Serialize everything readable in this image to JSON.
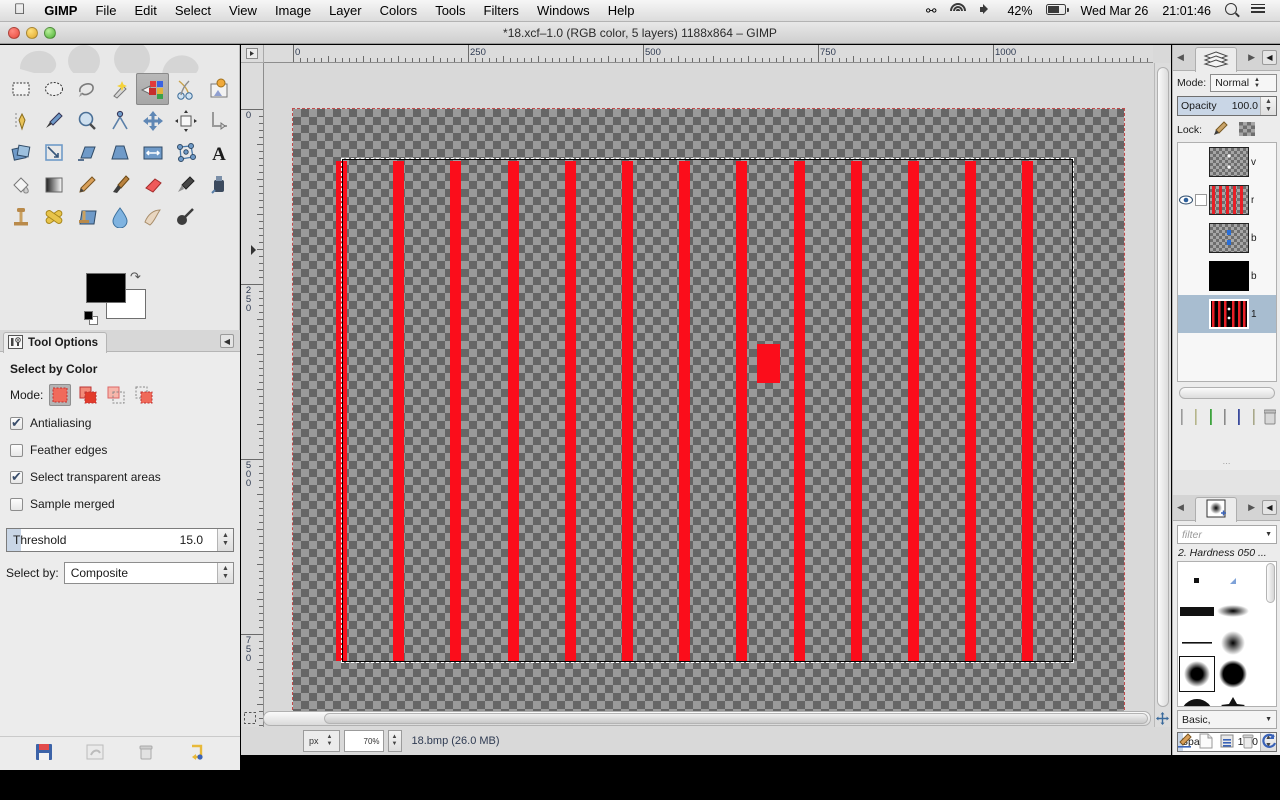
{
  "menubar": {
    "apple_icon": "apple-icon",
    "app_name": "GIMP",
    "items": [
      "File",
      "Edit",
      "Select",
      "View",
      "Image",
      "Layer",
      "Colors",
      "Tools",
      "Filters",
      "Windows",
      "Help"
    ],
    "status": {
      "bluetooth_icon": "bluetooth-icon",
      "wifi_icon": "wifi-icon",
      "volume_icon": "volume-icon",
      "battery_percent": "42%",
      "battery_icon": "battery-icon",
      "date": "Wed Mar 26",
      "time": "21:01:46",
      "search_icon": "search-icon",
      "menu_icon": "list-menu-icon"
    }
  },
  "window": {
    "title": "*18.xcf–1.0 (RGB color, 5 layers) 1188x864 – GIMP",
    "close_label": "close-button",
    "minimize_label": "minimize-button",
    "zoom_label": "zoom-button"
  },
  "toolbox": {
    "tools": [
      {
        "id": "rect-select-tool",
        "selected": false
      },
      {
        "id": "ellipse-select-tool",
        "selected": false
      },
      {
        "id": "free-select-tool",
        "selected": false
      },
      {
        "id": "fuzzy-select-tool",
        "selected": false
      },
      {
        "id": "select-by-color-tool",
        "selected": true
      },
      {
        "id": "scissors-select-tool",
        "selected": false
      },
      {
        "id": "foreground-select-tool",
        "selected": false
      },
      {
        "id": "paths-tool",
        "selected": false
      },
      {
        "id": "color-picker-tool",
        "selected": false
      },
      {
        "id": "zoom-tool",
        "selected": false
      },
      {
        "id": "measure-tool",
        "selected": false
      },
      {
        "id": "move-tool",
        "selected": false
      },
      {
        "id": "alignment-tool",
        "selected": false
      },
      {
        "id": "crop-tool",
        "selected": false
      },
      {
        "id": "rotate-tool",
        "selected": false
      },
      {
        "id": "scale-tool",
        "selected": false
      },
      {
        "id": "shear-tool",
        "selected": false
      },
      {
        "id": "perspective-tool",
        "selected": false
      },
      {
        "id": "flip-tool",
        "selected": false
      },
      {
        "id": "cage-transform-tool",
        "selected": false
      },
      {
        "id": "text-tool",
        "selected": false
      },
      {
        "id": "bucket-fill-tool",
        "selected": false
      },
      {
        "id": "gradient-tool",
        "selected": false
      },
      {
        "id": "pencil-tool",
        "selected": false
      },
      {
        "id": "paintbrush-tool",
        "selected": false
      },
      {
        "id": "eraser-tool",
        "selected": false
      },
      {
        "id": "airbrush-tool",
        "selected": false
      },
      {
        "id": "ink-tool",
        "selected": false
      },
      {
        "id": "clone-tool",
        "selected": false
      },
      {
        "id": "heal-tool",
        "selected": false
      },
      {
        "id": "perspective-clone-tool",
        "selected": false
      },
      {
        "id": "blur-sharpen-tool",
        "selected": false
      },
      {
        "id": "smudge-tool",
        "selected": false
      },
      {
        "id": "dodge-burn-tool",
        "selected": false
      }
    ],
    "foreground_color": "#000000",
    "background_color": "#ffffff",
    "swap_icon": "swap-colors-icon",
    "reset_icon": "default-colors-icon",
    "bottom_buttons": [
      "save-device-status-icon",
      "restore-tool-preset-icon",
      "delete-tool-preset-icon",
      "reset-tool-options-icon"
    ]
  },
  "tool_options": {
    "tab_label": "Tool Options",
    "tab_icon": "tool-options-icon",
    "collapse_icon": "collapse-left-icon",
    "title": "Select by Color",
    "mode_label": "Mode:",
    "modes": [
      "replace-selection",
      "add-to-selection",
      "subtract-from-selection",
      "intersect-with-selection"
    ],
    "mode_selected_index": 0,
    "checkboxes": [
      {
        "label": "Antialiasing",
        "checked": true
      },
      {
        "label": "Feather edges",
        "checked": false
      },
      {
        "label": "Select transparent areas",
        "checked": true
      },
      {
        "label": "Sample merged",
        "checked": false
      }
    ],
    "threshold_label": "Threshold",
    "threshold_value": "15.0",
    "select_by_label": "Select by:",
    "select_by_value": "Composite"
  },
  "canvas": {
    "hruler_labels": [
      "0",
      "250",
      "500",
      "750",
      "1000"
    ],
    "vruler_labels": [
      "0",
      "250",
      "500",
      "750"
    ],
    "stripe_color": "#fb0d1b",
    "stripe_count": 13,
    "layer_boundary_color": "#c24a4a",
    "quick_mask_icon": "quick-mask-icon",
    "nav_icon": "navigate-canvas-icon",
    "menu_arrow_icon": "menu-arrow-icon"
  },
  "statusbar": {
    "unit": "px",
    "zoom": "70%",
    "text": "18.bmp (26.0 MB)"
  },
  "layers_dock": {
    "tab_icon": "layers-icon",
    "prev_icon": "prev-tab-icon",
    "next_icon": "next-tab-icon",
    "config_icon": "dock-menu-icon",
    "mode_label": "Mode:",
    "mode_value": "Normal",
    "opacity_label": "Opacity",
    "opacity_value": "100.0",
    "lock_label": "Lock:",
    "lock_pixels_icon": "lock-pixels-icon",
    "lock_alpha_icon": "lock-alpha-icon",
    "layers": [
      {
        "name": "v",
        "visible": false,
        "active": false,
        "kind": "transparent-dots"
      },
      {
        "name": "r",
        "visible": true,
        "active": false,
        "kind": "red-stripes"
      },
      {
        "name": "b",
        "visible": false,
        "active": false,
        "kind": "blue-dots"
      },
      {
        "name": "b",
        "visible": false,
        "active": false,
        "kind": "black"
      },
      {
        "name": "1",
        "visible": false,
        "active": true,
        "kind": "red-black"
      }
    ],
    "buttons": [
      "new-layer-icon",
      "raise-layer-icon",
      "lower-layer-icon",
      "duplicate-layer-icon",
      "anchor-layer-icon",
      "merge-layer-icon",
      "delete-layer-icon"
    ]
  },
  "brushes_dock": {
    "tab_icon": "brushes-icon",
    "prev_icon": "prev-tab-icon",
    "next_icon": "next-tab-icon",
    "config_icon": "dock-menu-icon",
    "filter_placeholder": "filter",
    "filter_icon": "filter-dropdown-icon",
    "selected_brush": "2. Hardness 050 ...",
    "tag_value": "Basic,",
    "spacing_label": "Spa...",
    "spacing_value": "10.0",
    "buttons": [
      "edit-brush-icon",
      "new-brush-icon",
      "duplicate-brush-icon",
      "delete-brush-icon",
      "refresh-brushes-icon"
    ]
  }
}
